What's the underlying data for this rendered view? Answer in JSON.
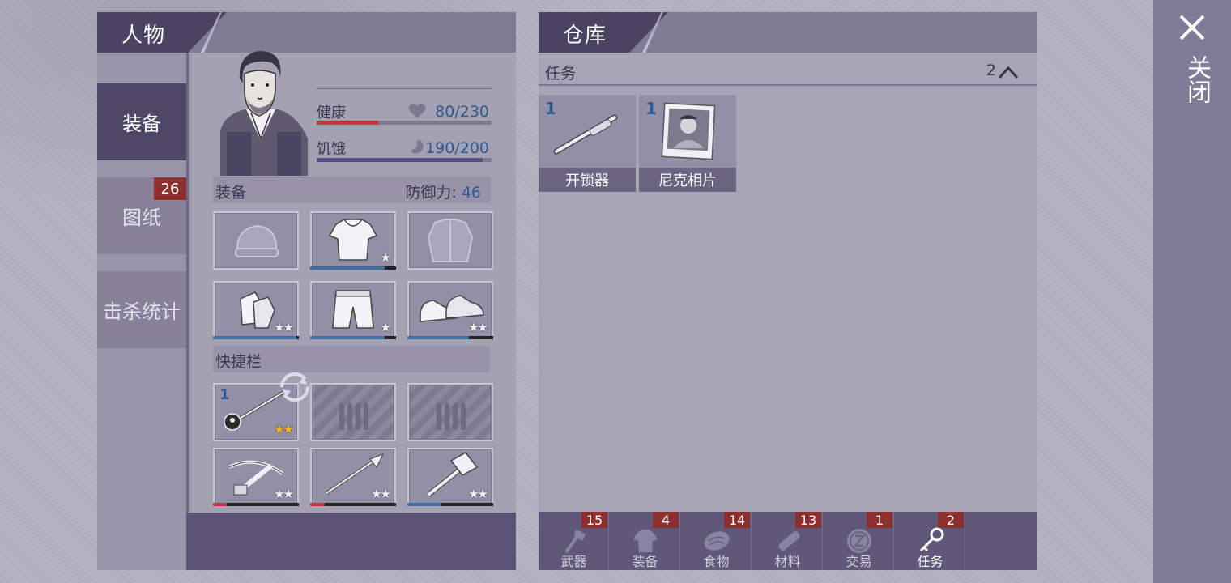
{
  "character_panel": {
    "title": "人物",
    "side_tabs": [
      {
        "label": "装备",
        "active": true
      },
      {
        "label": "图纸",
        "badge": "26"
      },
      {
        "label": "击杀统计"
      }
    ],
    "stats": {
      "health_label": "健康",
      "health_value": "80/230",
      "health_fraction": 0.35,
      "hunger_label": "饥饿",
      "hunger_value": "190/200",
      "hunger_fraction": 0.95
    },
    "equipment": {
      "section_label": "装备",
      "defense_label": "防御力:",
      "defense_value": "46",
      "slots": [
        {
          "icon": "beanie-hat-icon",
          "empty_silhouette": true
        },
        {
          "icon": "shirt-icon",
          "stars": "★",
          "durability": 0.87
        },
        {
          "icon": "jacket-icon",
          "empty_silhouette": true
        },
        {
          "icon": "gloves-icon",
          "stars": "★★",
          "durability": 0.97
        },
        {
          "icon": "shorts-icon",
          "stars": "★",
          "durability": 0.87
        },
        {
          "icon": "sneakers-icon",
          "stars": "★★",
          "durability": 0.72
        }
      ]
    },
    "hotbar": {
      "section_label": "快捷栏",
      "slots": [
        {
          "icon": "mace-weapon-icon",
          "qty": "1",
          "stars": "★★",
          "stars_color": "gold"
        },
        {
          "icon": "ammo-placeholder-icon",
          "empty": true
        },
        {
          "icon": "ammo-placeholder-icon",
          "empty": true
        },
        {
          "icon": "crossbow-icon",
          "stars": "★★",
          "durability": 0.16
        },
        {
          "icon": "spear-icon",
          "stars": "★★",
          "durability": 0.17
        },
        {
          "icon": "sledgehammer-icon",
          "stars": "★★",
          "durability": 0.39
        }
      ]
    }
  },
  "warehouse_panel": {
    "title": "仓库",
    "category": {
      "label": "任务",
      "count": "2"
    },
    "items": [
      {
        "qty": "1",
        "name": "开锁器",
        "icon": "lockpick-icon"
      },
      {
        "qty": "1",
        "name": "尼克相片",
        "icon": "photo-icon"
      }
    ],
    "bottom_tabs": [
      {
        "label": "武器",
        "badge": "15",
        "icon": "axe-icon"
      },
      {
        "label": "装备",
        "badge": "4",
        "icon": "shirt-icon"
      },
      {
        "label": "食物",
        "badge": "14",
        "icon": "meat-icon"
      },
      {
        "label": "材料",
        "badge": "13",
        "icon": "log-icon"
      },
      {
        "label": "交易",
        "badge": "1",
        "icon": "coin-icon"
      },
      {
        "label": "任务",
        "badge": "2",
        "icon": "key-icon",
        "active": true
      }
    ]
  },
  "close": {
    "label": "关闭"
  },
  "colors": {
    "health_bar": "#c8323c",
    "hunger_bar": "#5a4d86",
    "durability_blue": "#3d6fa5",
    "durability_red": "#c8323c",
    "badge_red": "#8c2f2f",
    "value_blue": "#2c5a91"
  }
}
